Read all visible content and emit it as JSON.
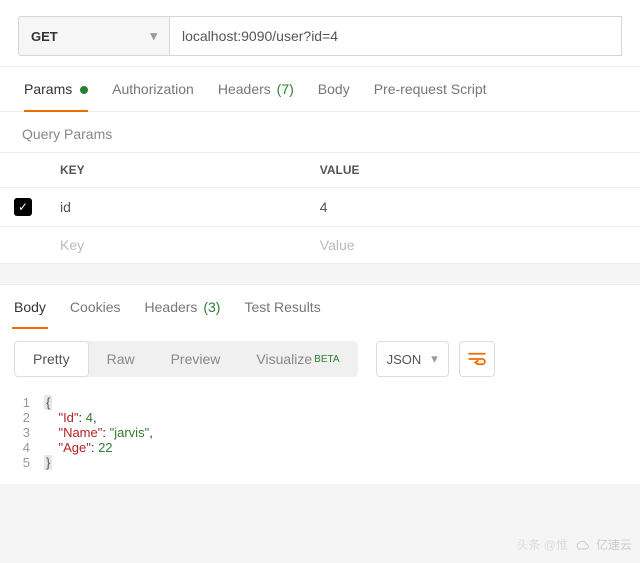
{
  "request": {
    "method": "GET",
    "url": "localhost:9090/user?id=4"
  },
  "tabs": {
    "params": "Params",
    "auth": "Authorization",
    "headers": "Headers",
    "headers_count": "(7)",
    "body": "Body",
    "prerequest": "Pre-request Script"
  },
  "query_params": {
    "title": "Query Params",
    "col_key": "KEY",
    "col_value": "VALUE",
    "rows": [
      {
        "checked": true,
        "key": "id",
        "value": "4"
      }
    ],
    "placeholder_key": "Key",
    "placeholder_value": "Value"
  },
  "resp_tabs": {
    "body": "Body",
    "cookies": "Cookies",
    "headers": "Headers",
    "headers_count": "(3)",
    "tests": "Test Results"
  },
  "formatter": {
    "pretty": "Pretty",
    "raw": "Raw",
    "preview": "Preview",
    "visualize": "Visualize",
    "beta": "BETA",
    "type": "JSON"
  },
  "response_body": {
    "Id": 4,
    "Name": "jarvis",
    "Age": 22
  },
  "watermark": {
    "left": "头条 @惟",
    "right": "亿速云"
  }
}
